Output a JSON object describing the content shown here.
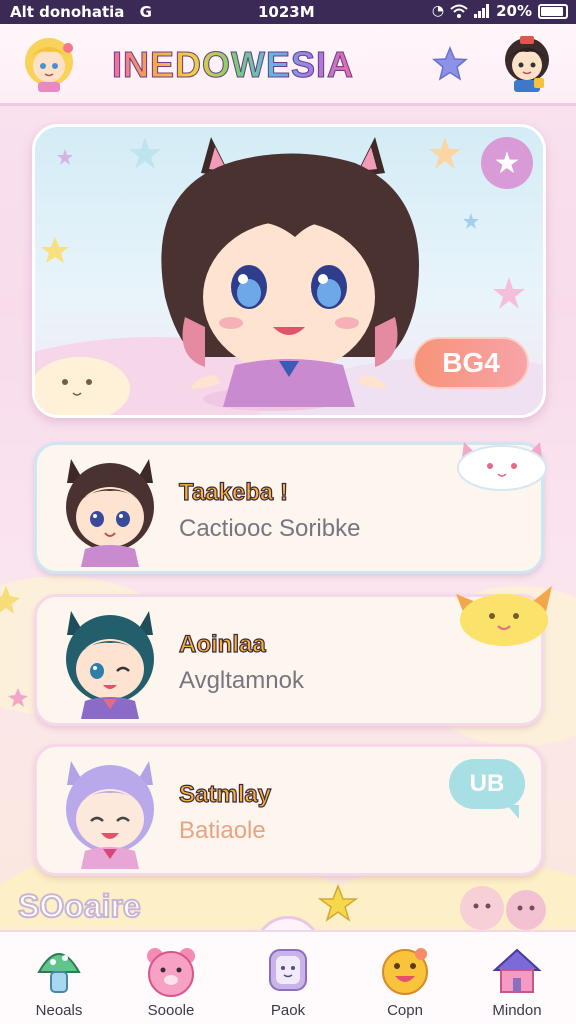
{
  "status_bar": {
    "left": "Alt donohatia",
    "left_icon": "G",
    "time": "1023M",
    "battery": "20%",
    "icons": [
      "alarm-icon",
      "wifi-icon",
      "signal-icon",
      "battery-icon"
    ]
  },
  "header": {
    "title": "INEDOWESIA",
    "left_avatar": "blonde-girl-avatar",
    "right_avatar": "brown-hair-boy-avatar",
    "star_icon": "star-icon"
  },
  "hero": {
    "badge": "BG4",
    "favorite_icon": "star-icon",
    "character": "cat-ear-girl-illustration"
  },
  "list": [
    {
      "name": "Taakeba !",
      "subtitle": "Cactiooc Soribke",
      "avatar": "brown-hair-cat-ear-avatar"
    },
    {
      "name": "Aoinlaa",
      "subtitle": "Avgltamnok",
      "avatar": "teal-hair-cat-ear-avatar"
    },
    {
      "name": "Satmlay",
      "subtitle": "Batiaole",
      "avatar": "lavender-hair-cat-ear-avatar",
      "bubble": "UB"
    }
  ],
  "footer_logo": "SOoaire",
  "nav": [
    {
      "label": "Neoals",
      "icon": "mushroom-icon"
    },
    {
      "label": "Sooole",
      "icon": "pink-bear-icon"
    },
    {
      "label": "Paok",
      "icon": "face-icon"
    },
    {
      "label": "Copn",
      "icon": "smiley-icon"
    },
    {
      "label": "Mindon",
      "icon": "house-icon"
    }
  ],
  "colors": {
    "accent_pink": "#f06aa8",
    "badge_orange": "#f79479",
    "name_yellow": "#f6b23a",
    "status_bar": "#3a2a55"
  }
}
